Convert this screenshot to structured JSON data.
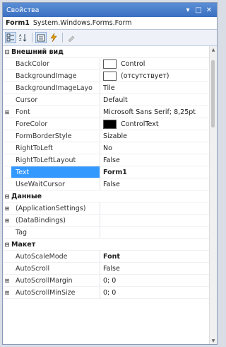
{
  "window": {
    "title": "Свойства",
    "pin": "▾",
    "restore": "□",
    "close": "✕"
  },
  "object": {
    "name": "Form1",
    "type": "System.Windows.Forms.Form"
  },
  "toolbar": [
    "categorized",
    "alphabetical",
    "properties",
    "events",
    "property-pages"
  ],
  "rows": [
    {
      "kind": "cat",
      "expander": "⊟",
      "name": "Внешний вид"
    },
    {
      "kind": "prop",
      "name": "BackColor",
      "value": "Control",
      "swatch": "#ffffff"
    },
    {
      "kind": "prop",
      "name": "BackgroundImage",
      "value": "(отсутствует)",
      "swatch": "#ffffff"
    },
    {
      "kind": "prop",
      "name": "BackgroundImageLayo",
      "value": "Tile"
    },
    {
      "kind": "prop",
      "name": "Cursor",
      "value": "Default"
    },
    {
      "kind": "prop",
      "name": "Font",
      "value": "Microsoft Sans Serif; 8,25pt",
      "expander": "⊞"
    },
    {
      "kind": "prop",
      "name": "ForeColor",
      "value": "ControlText",
      "swatch": "#000000"
    },
    {
      "kind": "prop",
      "name": "FormBorderStyle",
      "value": "Sizable"
    },
    {
      "kind": "prop",
      "name": "RightToLeft",
      "value": "No"
    },
    {
      "kind": "prop",
      "name": "RightToLeftLayout",
      "value": "False"
    },
    {
      "kind": "prop",
      "name": "Text",
      "value": "Form1",
      "selected": true
    },
    {
      "kind": "prop",
      "name": "UseWaitCursor",
      "value": "False"
    },
    {
      "kind": "cat",
      "expander": "⊟",
      "name": "Данные"
    },
    {
      "kind": "prop",
      "name": "(ApplicationSettings)",
      "value": "",
      "expander": "⊞"
    },
    {
      "kind": "prop",
      "name": "(DataBindings)",
      "value": "",
      "expander": "⊞"
    },
    {
      "kind": "prop",
      "name": "Tag",
      "value": ""
    },
    {
      "kind": "cat",
      "expander": "⊟",
      "name": "Макет"
    },
    {
      "kind": "prop",
      "name": "AutoScaleMode",
      "value": "Font",
      "bold": true
    },
    {
      "kind": "prop",
      "name": "AutoScroll",
      "value": "False"
    },
    {
      "kind": "prop",
      "name": "AutoScrollMargin",
      "value": "0; 0",
      "expander": "⊞"
    },
    {
      "kind": "prop",
      "name": "AutoScrollMinSize",
      "value": "0; 0",
      "expander": "⊞"
    }
  ]
}
